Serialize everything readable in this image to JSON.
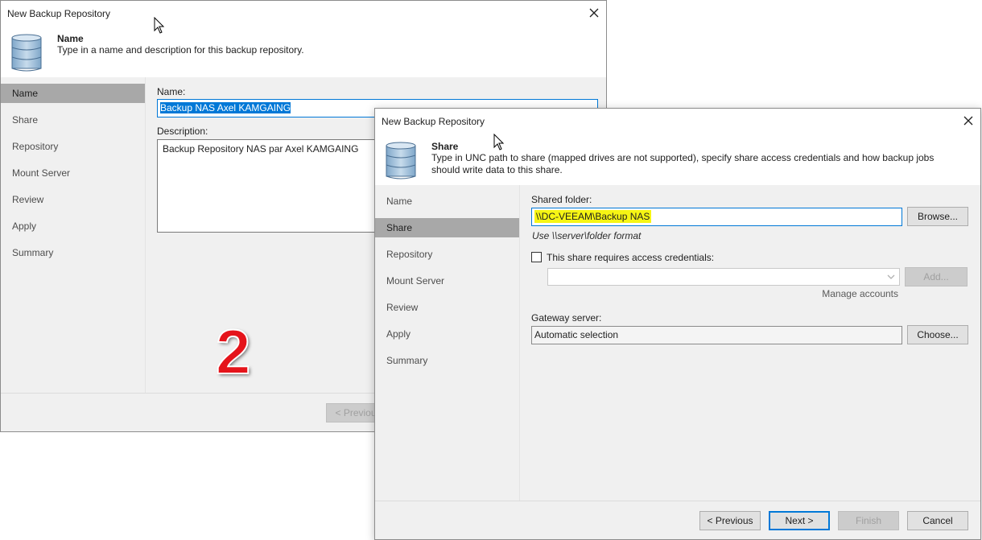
{
  "window1": {
    "title": "New Backup Repository",
    "step_title": "Name",
    "step_description": "Type in a name and description for this backup repository.",
    "nav": [
      "Name",
      "Share",
      "Repository",
      "Mount Server",
      "Review",
      "Apply",
      "Summary"
    ],
    "active_step": "Name",
    "name_label": "Name:",
    "name_value": "Backup NAS Axel KAMGAING",
    "description_label": "Description:",
    "description_value": "Backup Repository NAS par Axel KAMGAING",
    "previous_label": "< Previous"
  },
  "window2": {
    "title": "New Backup Repository",
    "step_title": "Share",
    "step_description": "Type in UNC path to share (mapped drives are not supported), specify share access credentials and how backup jobs should write data to this share.",
    "nav": [
      "Name",
      "Share",
      "Repository",
      "Mount Server",
      "Review",
      "Apply",
      "Summary"
    ],
    "active_step": "Share",
    "shared_folder_label": "Shared folder:",
    "shared_folder_value": "\\\\DC-VEEAM\\Backup NAS",
    "browse_label": "Browse...",
    "format_hint": "Use \\\\server\\folder format",
    "credentials_checkbox_label": "This share requires access credentials:",
    "credentials_checked": false,
    "add_label": "Add...",
    "manage_accounts_label": "Manage accounts",
    "gateway_label": "Gateway server:",
    "gateway_value": "Automatic selection",
    "choose_label": "Choose...",
    "buttons": {
      "previous": "< Previous",
      "next": "Next >",
      "finish": "Finish",
      "cancel": "Cancel"
    }
  },
  "annotation_number": "2",
  "colors": {
    "accent": "#0078d7",
    "highlight": "#f6f514",
    "nav_active": "#a8a8a8",
    "annotation": "#e5141b"
  },
  "icons": [
    "database-icon",
    "close-icon",
    "cursor-icon",
    "chevron-down-icon"
  ]
}
